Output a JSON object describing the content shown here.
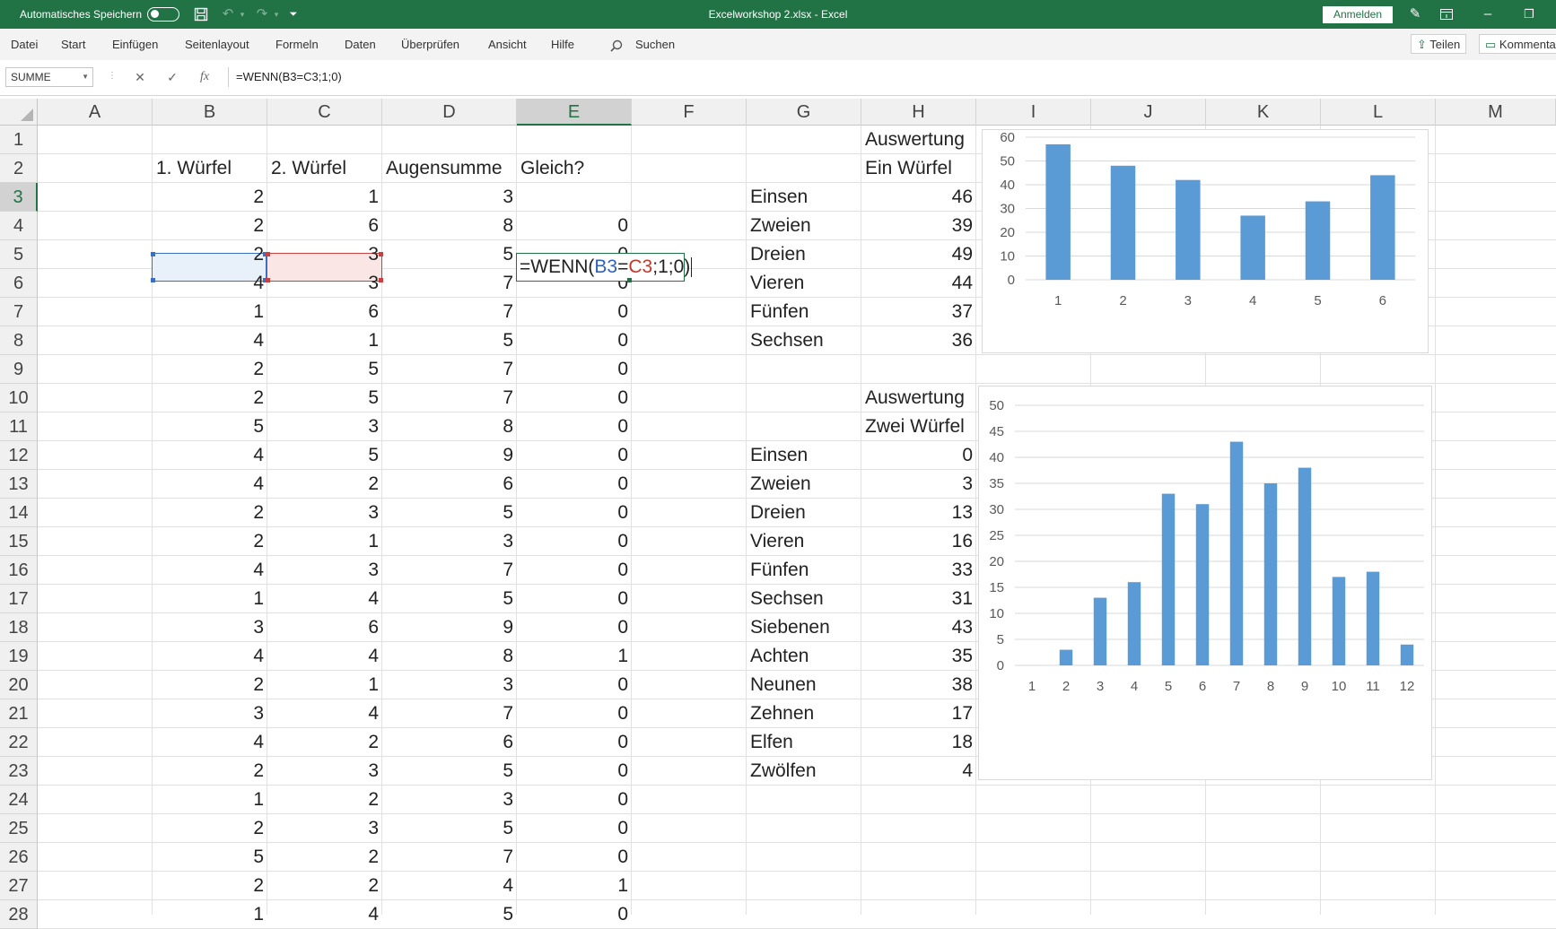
{
  "titlebar": {
    "autosave_label": "Automatisches Speichern",
    "document_title": "Excelworkshop 2.xlsx  -  Excel",
    "signin_label": "Anmelden",
    "brand_color": "#217346"
  },
  "menu": {
    "items": [
      "Datei",
      "Start",
      "Einfügen",
      "Seitenlayout",
      "Formeln",
      "Daten",
      "Überprüfen",
      "Ansicht",
      "Hilfe"
    ],
    "search_label": "Suchen",
    "share_label": "Teilen",
    "comments_label": "Kommentare"
  },
  "formula_bar": {
    "name_box": "SUMME",
    "cancel_symbol": "✕",
    "enter_symbol": "✓",
    "fx_symbol": "fx",
    "formula": "=WENN(B3=C3;1;0)"
  },
  "sheet": {
    "columns": [
      "A",
      "B",
      "C",
      "D",
      "E",
      "F",
      "G",
      "H",
      "I",
      "J",
      "K",
      "L",
      "M"
    ],
    "active_column": "E",
    "active_row": "3",
    "rows": [
      "1",
      "2",
      "3",
      "4",
      "5",
      "6",
      "7",
      "8",
      "9",
      "10",
      "11",
      "12",
      "13",
      "14",
      "15",
      "16",
      "17",
      "18",
      "19",
      "20",
      "21",
      "22",
      "23",
      "24",
      "25",
      "26",
      "27",
      "28"
    ],
    "headers": {
      "b": "1. Würfel",
      "c": "2. Würfel",
      "d": "Augensumme",
      "e": "Gleich?"
    },
    "edit_cell": {
      "prefix": "=WENN(",
      "ref1": "B3",
      "eq": "=",
      "ref2": "C3",
      "suffix": ";1;0)",
      "ref1_color": "#2f62c0",
      "ref2_color": "#c0392b"
    },
    "data": [
      [
        "2",
        "1",
        "3",
        ""
      ],
      [
        "2",
        "6",
        "8",
        "0"
      ],
      [
        "2",
        "3",
        "5",
        "0"
      ],
      [
        "4",
        "3",
        "7",
        "0"
      ],
      [
        "1",
        "6",
        "7",
        "0"
      ],
      [
        "4",
        "1",
        "5",
        "0"
      ],
      [
        "2",
        "5",
        "7",
        "0"
      ],
      [
        "2",
        "5",
        "7",
        "0"
      ],
      [
        "5",
        "3",
        "8",
        "0"
      ],
      [
        "4",
        "5",
        "9",
        "0"
      ],
      [
        "4",
        "2",
        "6",
        "0"
      ],
      [
        "2",
        "3",
        "5",
        "0"
      ],
      [
        "2",
        "1",
        "3",
        "0"
      ],
      [
        "4",
        "3",
        "7",
        "0"
      ],
      [
        "1",
        "4",
        "5",
        "0"
      ],
      [
        "3",
        "6",
        "9",
        "0"
      ],
      [
        "4",
        "4",
        "8",
        "1"
      ],
      [
        "2",
        "1",
        "3",
        "0"
      ],
      [
        "3",
        "4",
        "7",
        "0"
      ],
      [
        "4",
        "2",
        "6",
        "0"
      ],
      [
        "2",
        "3",
        "5",
        "0"
      ],
      [
        "1",
        "2",
        "3",
        "0"
      ],
      [
        "2",
        "3",
        "5",
        "0"
      ],
      [
        "5",
        "2",
        "7",
        "0"
      ],
      [
        "2",
        "2",
        "4",
        "1"
      ],
      [
        "1",
        "4",
        "5",
        "0"
      ]
    ],
    "one_die": {
      "title1": "Auswertung",
      "title2": "Ein Würfel",
      "labels": [
        "Einsen",
        "Zweien",
        "Dreien",
        "Vieren",
        "Fünfen",
        "Sechsen"
      ],
      "values": [
        "46",
        "39",
        "49",
        "44",
        "37",
        "36"
      ]
    },
    "two_dice": {
      "title1": "Auswertung",
      "title2": "Zwei Würfel",
      "labels": [
        "Einsen",
        "Zweien",
        "Dreien",
        "Vieren",
        "Fünfen",
        "Sechsen",
        "Siebenen",
        "Achten",
        "Neunen",
        "Zehnen",
        "Elfen",
        "Zwölfen"
      ],
      "values": [
        "0",
        "3",
        "13",
        "16",
        "33",
        "31",
        "43",
        "35",
        "38",
        "17",
        "18",
        "4"
      ]
    }
  },
  "chart_data": [
    {
      "type": "bar",
      "title": "",
      "categories": [
        "1",
        "2",
        "3",
        "4",
        "5",
        "6"
      ],
      "values": [
        57,
        48,
        42,
        27,
        33,
        44
      ],
      "ylim": [
        0,
        60
      ],
      "yticks": [
        "0",
        "10",
        "20",
        "30",
        "40",
        "50",
        "60"
      ],
      "grid": true,
      "bar_color": "#5b9bd5"
    },
    {
      "type": "bar",
      "title": "",
      "categories": [
        "1",
        "2",
        "3",
        "4",
        "5",
        "6",
        "7",
        "8",
        "9",
        "10",
        "11",
        "12"
      ],
      "values": [
        0,
        3,
        13,
        16,
        33,
        31,
        43,
        35,
        38,
        17,
        18,
        4
      ],
      "ylim": [
        0,
        50
      ],
      "yticks": [
        "0",
        "5",
        "10",
        "15",
        "20",
        "25",
        "30",
        "35",
        "40",
        "45",
        "50"
      ],
      "grid": true,
      "bar_color": "#5b9bd5"
    }
  ]
}
